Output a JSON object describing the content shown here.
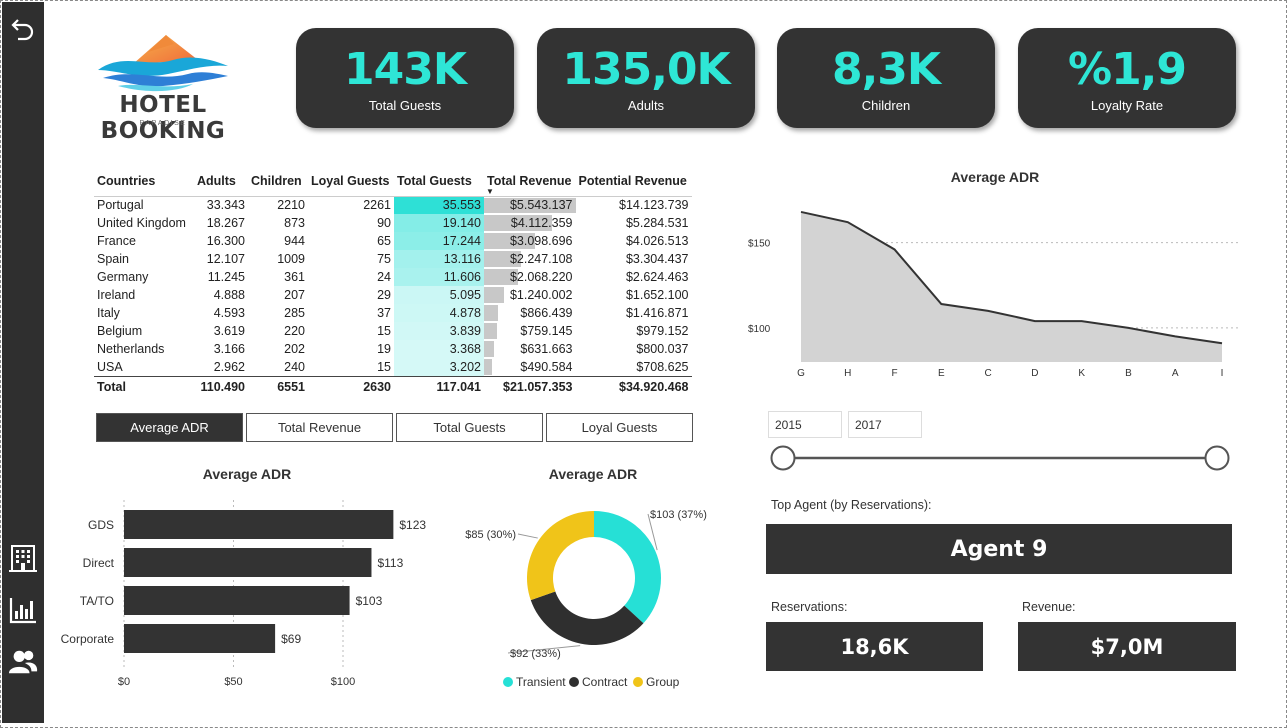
{
  "brand": {
    "title": "HOTEL BOOKING",
    "subtitle": "PARADISE"
  },
  "kpis": [
    {
      "value": "143K",
      "label": "Total Guests"
    },
    {
      "value": "135,0K",
      "label": "Adults"
    },
    {
      "value": "8,3K",
      "label": "Children"
    },
    {
      "value": "%1,9",
      "label": "Loyalty Rate"
    }
  ],
  "table": {
    "headers": [
      "Countries",
      "Adults",
      "Children",
      "Loyal Guests",
      "Total Guests",
      "Total Revenue",
      "Potential Revenue"
    ],
    "rows": [
      {
        "country": "Portugal",
        "adults": "33.343",
        "children": "2210",
        "loyal": "2261",
        "total": "35.553",
        "revenue": "$5.543.137",
        "potential": "$14.123.739",
        "tg": 35553,
        "rv": 5543137
      },
      {
        "country": "United Kingdom",
        "adults": "18.267",
        "children": "873",
        "loyal": "90",
        "total": "19.140",
        "revenue": "$4.112.359",
        "potential": "$5.284.531",
        "tg": 19140,
        "rv": 4112359
      },
      {
        "country": "France",
        "adults": "16.300",
        "children": "944",
        "loyal": "65",
        "total": "17.244",
        "revenue": "$3.098.696",
        "potential": "$4.026.513",
        "tg": 17244,
        "rv": 3098696
      },
      {
        "country": "Spain",
        "adults": "12.107",
        "children": "1009",
        "loyal": "75",
        "total": "13.116",
        "revenue": "$2.247.108",
        "potential": "$3.304.437",
        "tg": 13116,
        "rv": 2247108
      },
      {
        "country": "Germany",
        "adults": "11.245",
        "children": "361",
        "loyal": "24",
        "total": "11.606",
        "revenue": "$2.068.220",
        "potential": "$2.624.463",
        "tg": 11606,
        "rv": 2068220
      },
      {
        "country": "Ireland",
        "adults": "4.888",
        "children": "207",
        "loyal": "29",
        "total": "5.095",
        "revenue": "$1.240.002",
        "potential": "$1.652.100",
        "tg": 5095,
        "rv": 1240002
      },
      {
        "country": "Italy",
        "adults": "4.593",
        "children": "285",
        "loyal": "37",
        "total": "4.878",
        "revenue": "$866.439",
        "potential": "$1.416.871",
        "tg": 4878,
        "rv": 866439
      },
      {
        "country": "Belgium",
        "adults": "3.619",
        "children": "220",
        "loyal": "15",
        "total": "3.839",
        "revenue": "$759.145",
        "potential": "$979.152",
        "tg": 3839,
        "rv": 759145
      },
      {
        "country": "Netherlands",
        "adults": "3.166",
        "children": "202",
        "loyal": "19",
        "total": "3.368",
        "revenue": "$631.663",
        "potential": "$800.037",
        "tg": 3368,
        "rv": 631663
      },
      {
        "country": "USA",
        "adults": "2.962",
        "children": "240",
        "loyal": "15",
        "total": "3.202",
        "revenue": "$490.584",
        "potential": "$708.625",
        "tg": 3202,
        "rv": 490584
      }
    ],
    "total": {
      "label": "Total",
      "adults": "110.490",
      "children": "6551",
      "loyal": "2630",
      "total": "117.041",
      "revenue": "$21.057.353",
      "potential": "$34.920.468"
    }
  },
  "selector": {
    "buttons": [
      "Average ADR",
      "Total Revenue",
      "Total Guests",
      "Loyal Guests"
    ],
    "active": 0
  },
  "years": {
    "start": "2015",
    "end": "2017"
  },
  "agent": {
    "top_label": "Top Agent (by Reservations):",
    "top_value": "Agent 9",
    "reservations_label": "Reservations:",
    "reservations_value": "18,6K",
    "revenue_label": "Revenue:",
    "revenue_value": "$7,0M"
  },
  "icons": [
    "back-arrow-icon",
    "building-icon",
    "bar-chart-icon",
    "users-icon"
  ],
  "colors": {
    "accent": "#2ee6d6",
    "dark": "#333333",
    "transient": "#26e0d6",
    "contract": "#2f2f2f",
    "group": "#f0c419",
    "area": "#d3d3d3"
  },
  "chart_data": [
    {
      "type": "area",
      "title": "Average ADR",
      "categories": [
        "G",
        "H",
        "F",
        "E",
        "C",
        "D",
        "K",
        "B",
        "A",
        "I"
      ],
      "values": [
        168,
        162,
        146,
        114,
        110,
        104,
        104,
        100,
        95,
        91
      ],
      "yticks": [
        "$100",
        "$150"
      ],
      "ylim": [
        80,
        175
      ]
    },
    {
      "type": "bar",
      "title": "Average ADR",
      "categories": [
        "GDS",
        "Direct",
        "TA/TO",
        "Corporate"
      ],
      "values": [
        123,
        113,
        103,
        69
      ],
      "labels": [
        "$123",
        "$113",
        "$103",
        "$69"
      ],
      "xticks": [
        "$0",
        "$50",
        "$100"
      ],
      "xlim": [
        0,
        140
      ]
    },
    {
      "type": "pie",
      "title": "Average ADR",
      "categories": [
        "Transient",
        "Contract",
        "Group"
      ],
      "values": [
        103,
        92,
        85
      ],
      "labels": [
        "$103 (37%)",
        "$92 (33%)",
        "$85 (30%)"
      ]
    }
  ]
}
